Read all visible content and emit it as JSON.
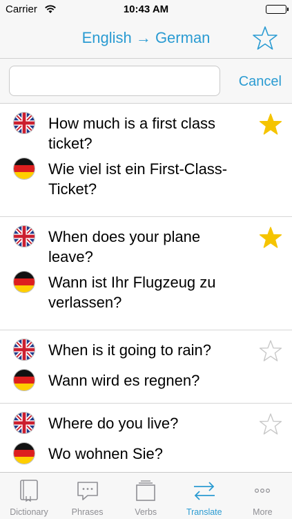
{
  "status_bar": {
    "carrier": "Carrier",
    "time": "10:43 AM",
    "battery_level": 1.0
  },
  "nav": {
    "title": "English → German",
    "favorite_icon": "star-outline-icon"
  },
  "search": {
    "value": "",
    "placeholder": "",
    "cancel_label": "Cancel"
  },
  "entries": [
    {
      "english": "How much is a first class ticket?",
      "german": "Wie viel ist ein First-Class-Ticket?",
      "starred": true
    },
    {
      "english": "When does your plane leave?",
      "german": "Wann ist Ihr Flugzeug zu verlassen?",
      "starred": true
    },
    {
      "english": "When is it going to rain?",
      "german": "Wann wird es regnen?",
      "starred": false
    },
    {
      "english": "Where do you live?",
      "german": "Wo wohnen Sie?",
      "starred": false
    }
  ],
  "tabs": [
    {
      "label": "Dictionary",
      "icon": "book-icon",
      "active": false
    },
    {
      "label": "Phrases",
      "icon": "speech-bubble-icon",
      "active": false
    },
    {
      "label": "Verbs",
      "icon": "stack-icon",
      "active": false
    },
    {
      "label": "Translate",
      "icon": "swap-arrows-icon",
      "active": true
    },
    {
      "label": "More",
      "icon": "ellipsis-icon",
      "active": false
    }
  ],
  "colors": {
    "accent": "#2a9bd2",
    "star_filled": "#f5c400",
    "star_outline": "#c8c8c8",
    "tab_inactive": "#8e8e93"
  }
}
